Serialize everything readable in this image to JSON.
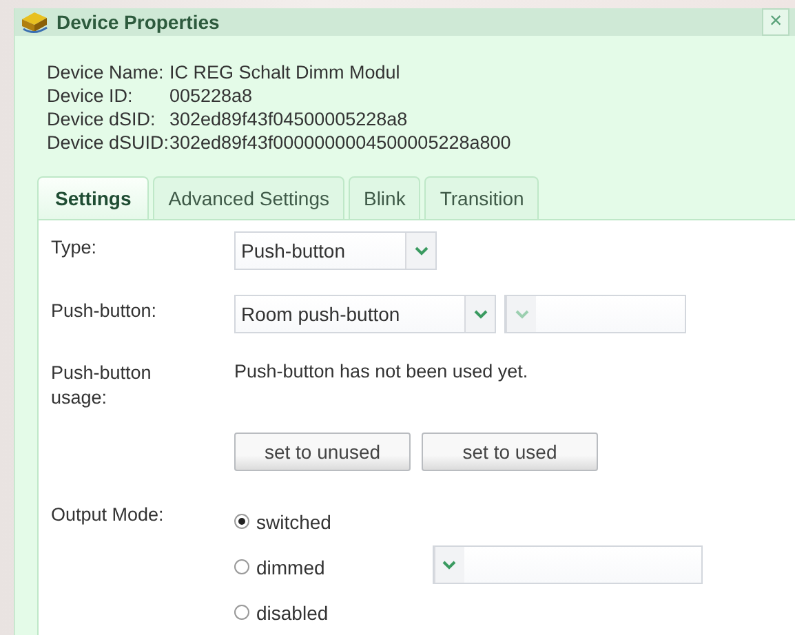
{
  "window": {
    "title": "Device Properties",
    "close": "×"
  },
  "info": [
    {
      "label": "Device Name:",
      "value": "IC REG Schalt Dimm Modul"
    },
    {
      "label": "Device ID:",
      "value": "005228a8"
    },
    {
      "label": "Device dSID:",
      "value": "302ed89f43f04500005228a8"
    },
    {
      "label": "Device dSUID:",
      "value": "302ed89f43f0000000004500005228a800"
    }
  ],
  "tabs": [
    {
      "label": "Settings",
      "selected": true
    },
    {
      "label": "Advanced Settings",
      "selected": false
    },
    {
      "label": "Blink",
      "selected": false
    },
    {
      "label": "Transition",
      "selected": false
    }
  ],
  "settings": {
    "type": {
      "label": "Type:",
      "value": "Push-button"
    },
    "push_button": {
      "label": "Push-button:",
      "value": "Room push-button"
    },
    "usage": {
      "label": "Push-button usage:",
      "text": "Push-button has not been used yet.",
      "buttons": [
        "set to unused",
        "set to used"
      ]
    },
    "output_mode": {
      "label": "Output Mode:",
      "options": [
        {
          "label": "switched",
          "selected": true
        },
        {
          "label": "dimmed",
          "selected": false
        },
        {
          "label": "disabled",
          "selected": false
        }
      ]
    }
  }
}
